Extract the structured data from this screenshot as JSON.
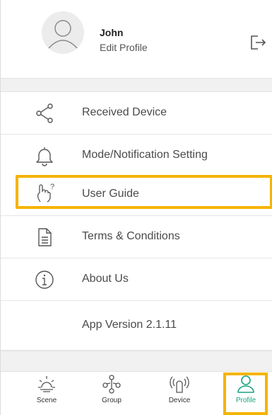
{
  "profile": {
    "name": "John",
    "edit_label": "Edit Profile"
  },
  "menu": {
    "received_device": "Received Device",
    "mode_notification": "Mode/Notification Setting",
    "user_guide": "User Guide",
    "terms": "Terms & Conditions",
    "about": "About Us",
    "app_version": "App Version 2.1.11"
  },
  "nav": {
    "scene": "Scene",
    "group": "Group",
    "device": "Device",
    "profile": "Profile"
  },
  "colors": {
    "accent": "#19a47e",
    "highlight": "#f5b400",
    "icon": "#555555"
  }
}
